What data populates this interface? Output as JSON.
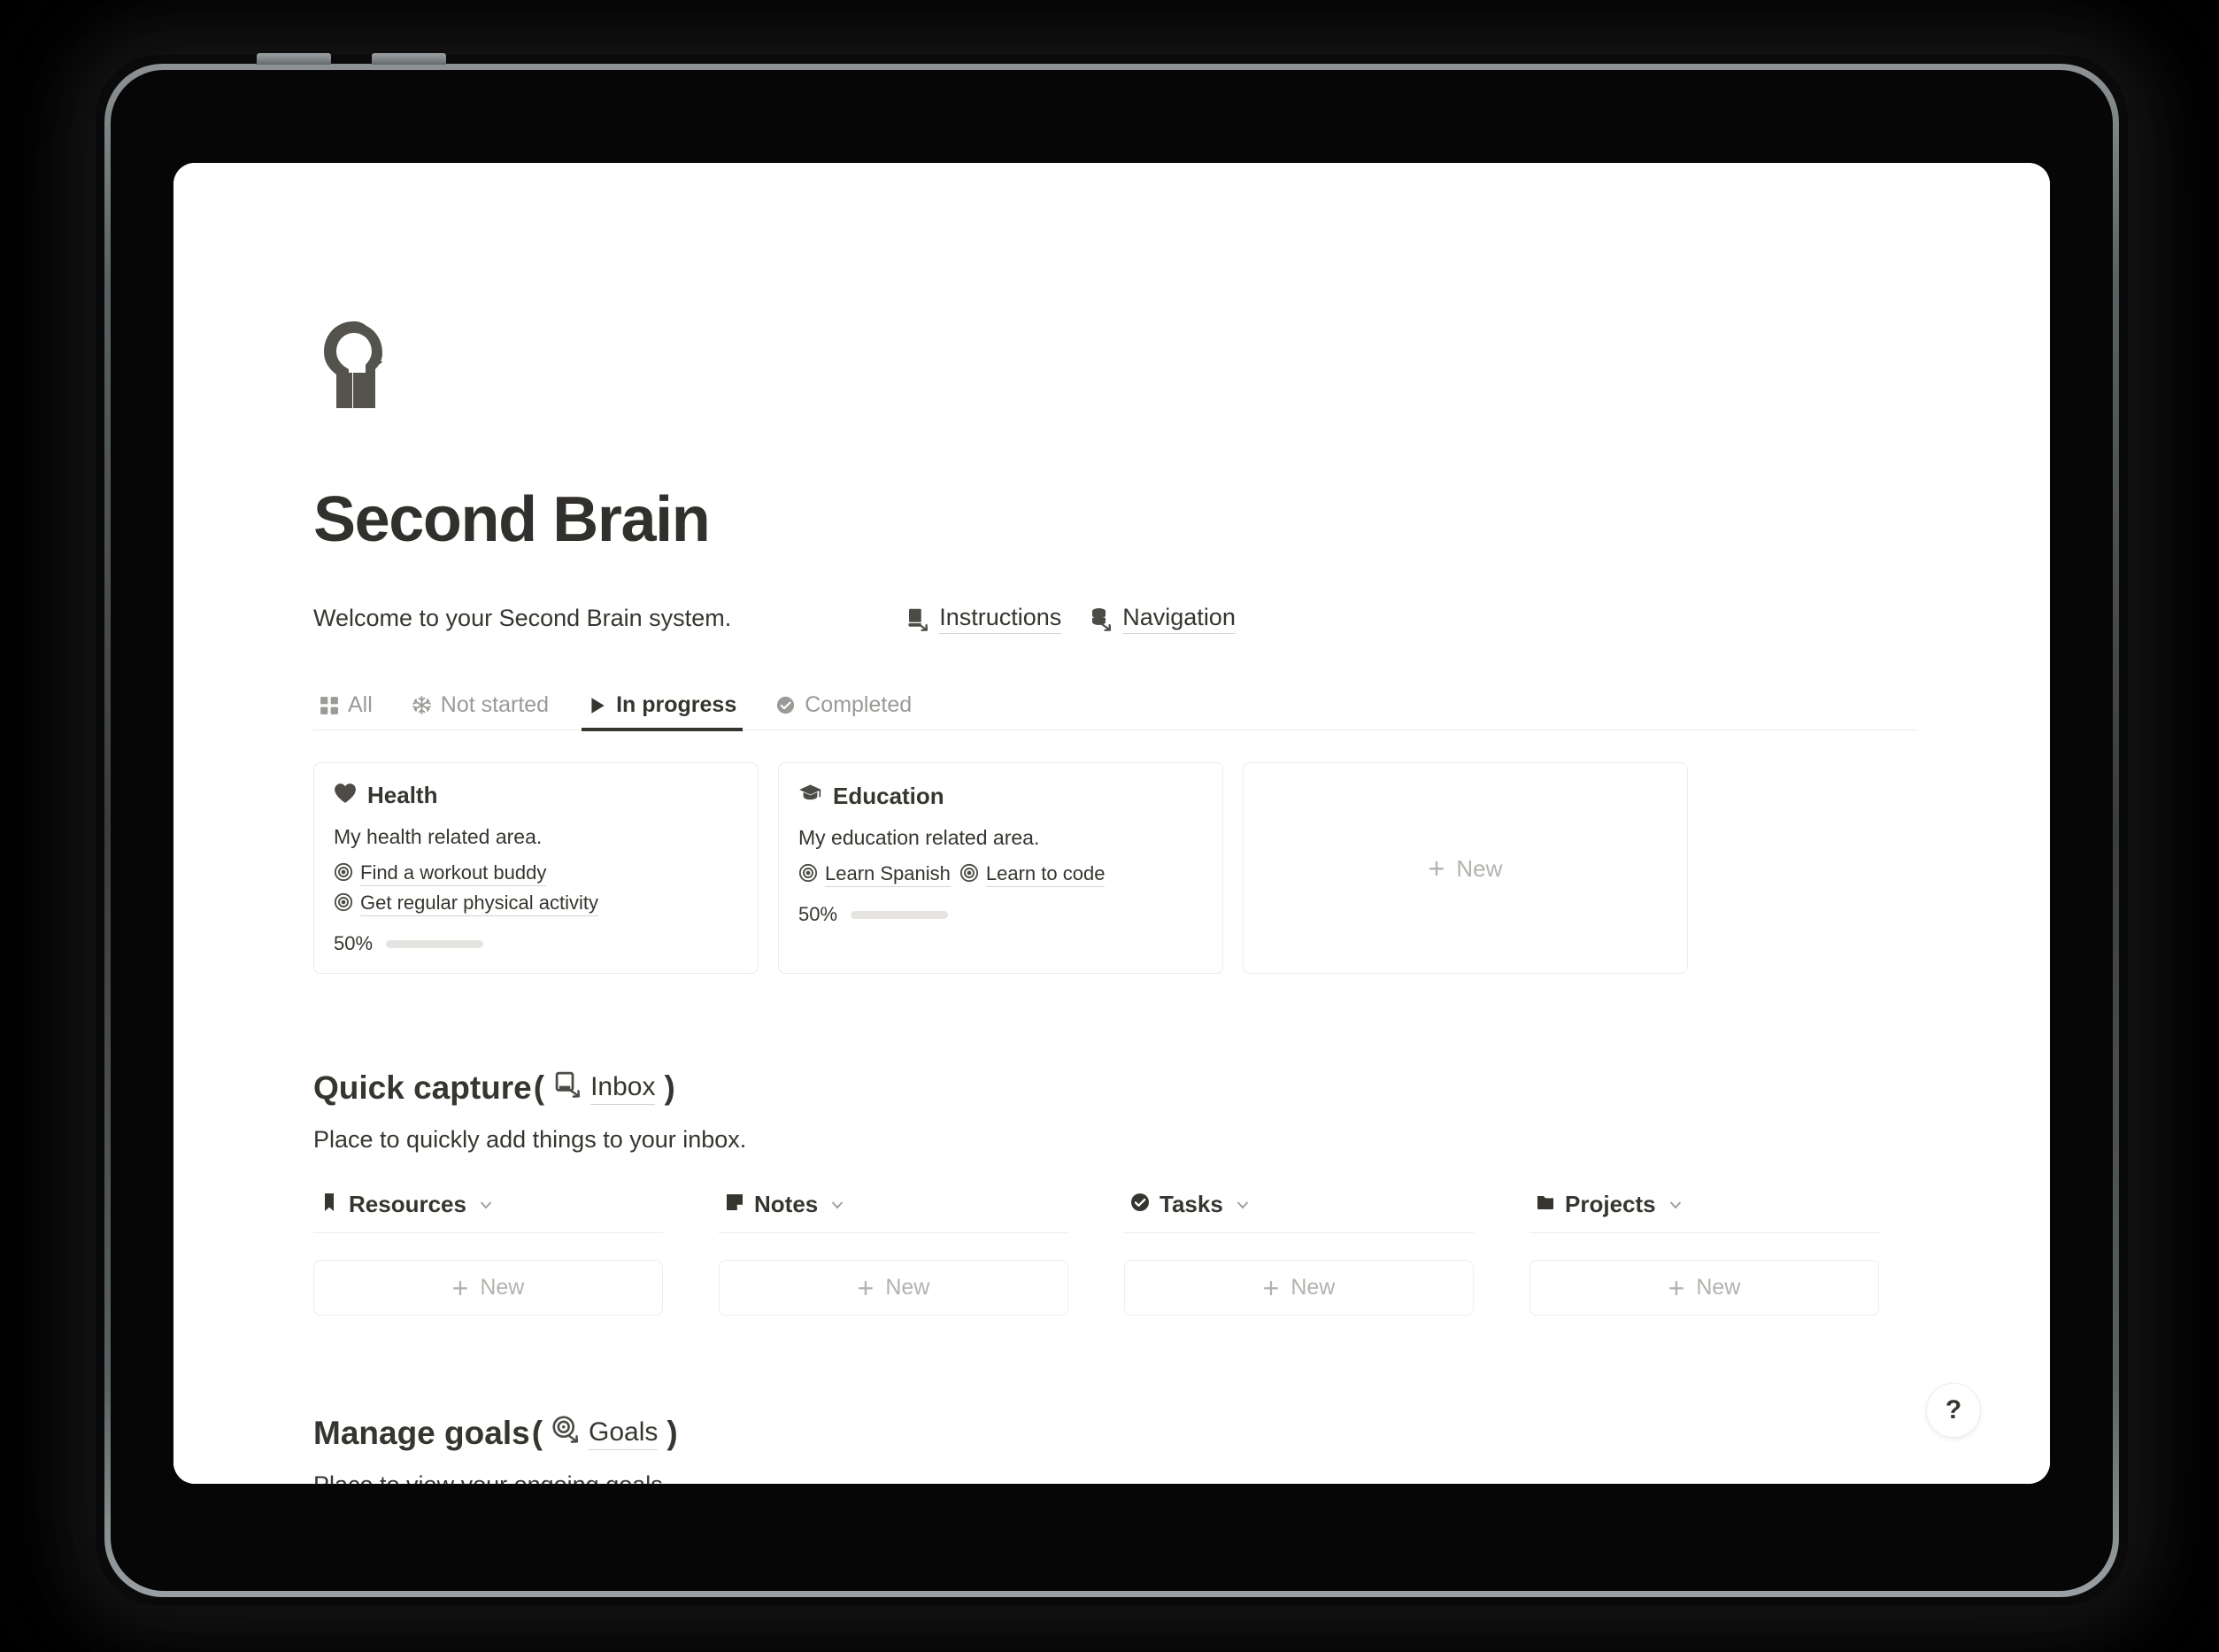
{
  "page": {
    "icon_name": "head-profile-icon",
    "title": "Second Brain",
    "welcome_text": "Welcome to your Second Brain system."
  },
  "quick_links": [
    {
      "label": "Instructions",
      "icon": "book-arrow-icon"
    },
    {
      "label": "Navigation",
      "icon": "database-arrow-icon"
    }
  ],
  "tabs": [
    {
      "label": "All",
      "icon": "grid-icon",
      "active": false
    },
    {
      "label": "Not started",
      "icon": "snowflake-icon",
      "active": false
    },
    {
      "label": "In progress",
      "icon": "play-triangle-icon",
      "active": true
    },
    {
      "label": "Completed",
      "icon": "check-circle-icon",
      "active": false
    }
  ],
  "area_cards": [
    {
      "title": "Health",
      "icon": "heart-icon",
      "description": "My health related area.",
      "goals": [
        "Find a workout buddy",
        "Get regular physical activity"
      ],
      "progress_label": "50%",
      "progress_value": 50
    },
    {
      "title": "Education",
      "icon": "graduation-cap-icon",
      "description": "My education related area.",
      "goals": [
        "Learn Spanish",
        "Learn to code"
      ],
      "progress_label": "50%",
      "progress_value": 50
    }
  ],
  "new_area_card": {
    "label": "New",
    "plus": "+"
  },
  "quick_capture": {
    "heading_prefix": "Quick capture",
    "open_paren": "(",
    "close_paren": ")",
    "link_label": "Inbox",
    "link_icon": "inbox-arrow-icon",
    "description": "Place to quickly add things to your inbox.",
    "columns": [
      {
        "title": "Resources",
        "icon": "bookmark-icon",
        "new_label": "New",
        "plus": "+"
      },
      {
        "title": "Notes",
        "icon": "note-icon",
        "new_label": "New",
        "plus": "+"
      },
      {
        "title": "Tasks",
        "icon": "check-circle-icon",
        "new_label": "New",
        "plus": "+"
      },
      {
        "title": "Projects",
        "icon": "folder-icon",
        "new_label": "New",
        "plus": "+"
      }
    ]
  },
  "manage_goals": {
    "heading_prefix": "Manage goals",
    "open_paren": "(",
    "close_paren": ")",
    "link_label": "Goals",
    "link_icon": "target-arrow-icon",
    "description": "Place to view your ongoing goals."
  },
  "help_button": {
    "label": "?"
  },
  "colors": {
    "text": "#37352f",
    "muted": "#9b9a97",
    "placeholder": "#b4b2ae",
    "border": "#eceae6",
    "progress_fill": "#6b9b7a",
    "progress_track": "#e6e4e0"
  }
}
